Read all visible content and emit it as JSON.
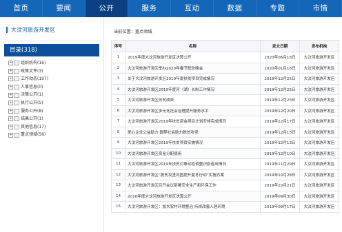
{
  "nav": [
    "首页",
    "要闻",
    "公开",
    "服务",
    "互动",
    "数据",
    "专题",
    "市情"
  ],
  "nav_active": 2,
  "sidebar": {
    "title": "大汶河旅游开发区",
    "catalog_label": "目录(318)",
    "items": [
      {
        "label": "组织机构(16)"
      },
      {
        "label": "政策文件(3)"
      },
      {
        "label": "工作动态(197)"
      },
      {
        "label": "人事信息(0)"
      },
      {
        "label": "决策公开(1)"
      },
      {
        "label": "执行公开(5)"
      },
      {
        "label": "服务公开(8)"
      },
      {
        "label": "结果公开(1)"
      },
      {
        "label": "其他信息(17)"
      },
      {
        "label": "重点领域(56)"
      }
    ]
  },
  "breadcrumb": "当前位置：重点领域",
  "table": {
    "headers": [
      "序号",
      "名称",
      "发文日期",
      "发布机构"
    ],
    "rows": [
      {
        "num": "1",
        "title": "2019年度大汶河旅游开发区决算公开",
        "date": "2020年06月18日",
        "org": "大汶河旅游开发区"
      },
      {
        "num": "2",
        "title": "大汶河旅游开发区举办2020年春节联欢晚会",
        "date": "2020年01月16日",
        "org": "大汶河旅游开发区"
      },
      {
        "num": "3",
        "title": "关于大汶河旅游开发区2019年度扶贫项目完成情况",
        "date": "2019年12月25日",
        "org": "大汶河旅游开发区"
      },
      {
        "num": "4",
        "title": "大汶河旅游开发区2019年度河（湖）长制工作情况",
        "date": "2019年12月25日",
        "org": "大汶河旅游开发区"
      },
      {
        "num": "5",
        "title": "大汶河旅游开发区扶贫成效",
        "date": "2019年12月23日",
        "org": "大汶河旅游开发区"
      },
      {
        "num": "6",
        "title": "大汶河旅游开发区多元化社会治理提升服务水平",
        "date": "2019年12月20日",
        "org": "大汶河旅游开发区"
      },
      {
        "num": "7",
        "title": "大汶河旅游开发区2019年扶贫资金项目计划安排完成情况",
        "date": "2019年12月17日",
        "org": "大汶河旅游开发区"
      },
      {
        "num": "8",
        "title": "爱心企业公益助力 圆梦社会助力脱贫攻坚",
        "date": "2019年12月13日",
        "org": "大汶河旅游开发区"
      },
      {
        "num": "9",
        "title": "大汶河旅游开发区2019年扶贫项目实施情况",
        "date": "2019年12月13日",
        "org": "大汶河旅游开发区"
      },
      {
        "num": "10",
        "title": "大汶河旅游开发区资金分配使用",
        "date": "2019年12月10日",
        "org": "大汶河旅游开发区"
      },
      {
        "num": "11",
        "title": "大汶河旅游开发区2019年扶贫对象动态调整识别退出情况",
        "date": "2019年11月29日",
        "org": "大汶河旅游开发区"
      },
      {
        "num": "12",
        "title": "大汶河旅游开发区“脱贫攻坚巩固提升夏冬行动”实施方案",
        "date": "2019年10月28日",
        "org": "大汶河旅游开发区"
      },
      {
        "num": "13",
        "title": "大汶河旅游开发区召开会议部署安全生产和环保工作",
        "date": "2019年10月21日",
        "org": "大汶河旅游开发区"
      },
      {
        "num": "14",
        "title": "2018年度大汶河旅游开发区决算公开",
        "date": "2019年09月30日",
        "org": "大汶河旅游开发区"
      },
      {
        "num": "15",
        "title": "大汶河旅游开发区：加大农村环境整治 持续改善人居环境",
        "date": "2019年09月17日",
        "org": "大汶河旅游开发区"
      }
    ]
  },
  "colors": {
    "nav_bg": "#1466b8",
    "nav_active": "#0b3f82",
    "catalog_bg": "#0e4f9c"
  }
}
